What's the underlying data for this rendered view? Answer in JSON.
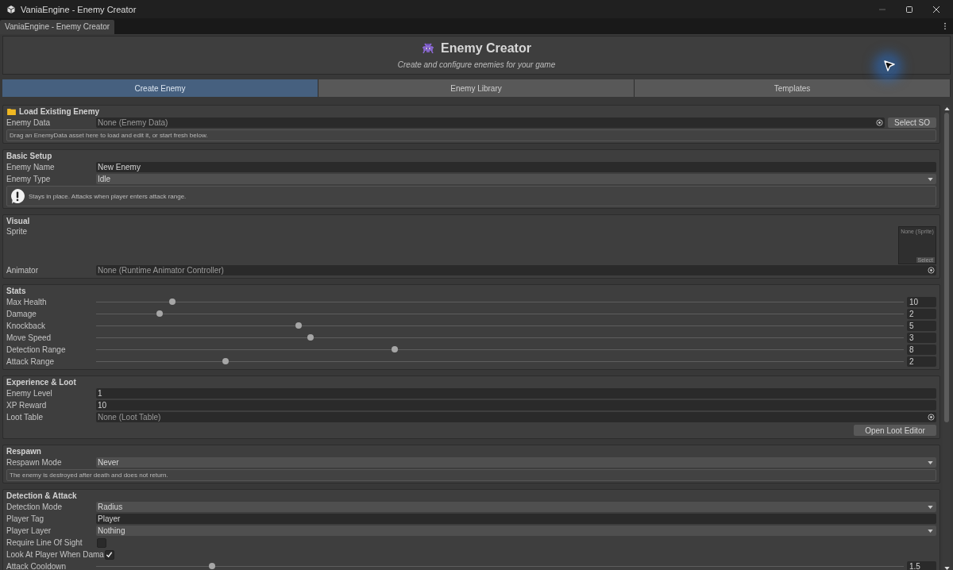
{
  "window": {
    "title": "VaniaEngine - Enemy Creator"
  },
  "dock_tab": {
    "label": "VaniaEngine - Enemy Creator",
    "selected": true
  },
  "header": {
    "title": "Enemy Creator",
    "subtitle": "Create and configure enemies for your game"
  },
  "tabs": [
    {
      "label": "Create Enemy",
      "selected": true
    },
    {
      "label": "Enemy Library",
      "selected": false
    },
    {
      "label": "Templates",
      "selected": false
    }
  ],
  "sections": [
    {
      "title": "Load Existing Enemy",
      "has_icon": true,
      "rows": [
        {
          "kind": "object",
          "label": "Enemy Data",
          "value": "None (Enemy Data)",
          "button": "Select SO"
        },
        {
          "kind": "note",
          "text": "Drag an EnemyData asset here to load and edit it, or start fresh below."
        }
      ]
    },
    {
      "title": "Basic Setup",
      "has_icon": false,
      "rows": [
        {
          "kind": "text",
          "label": "Enemy Name",
          "value": "New Enemy"
        },
        {
          "kind": "dropdown",
          "label": "Enemy Type",
          "value": "Idle"
        },
        {
          "kind": "info",
          "text": "Stays in place. Attacks when player enters attack range."
        }
      ]
    },
    {
      "title": "Visual",
      "has_icon": false,
      "rows": [
        {
          "kind": "sprite",
          "label": "Sprite",
          "value": "None (Sprite)",
          "button": "Select"
        },
        {
          "kind": "object",
          "label": "Animator",
          "value": "None (Runtime Animator Controller)"
        }
      ]
    },
    {
      "title": "Stats",
      "has_icon": false,
      "rows": [
        {
          "kind": "slider",
          "label": "Max Health",
          "level": 0.094,
          "value": "10"
        },
        {
          "kind": "slider",
          "label": "Damage",
          "level": 0.079,
          "value": "2"
        },
        {
          "kind": "slider",
          "label": "Knockback",
          "level": 0.251,
          "value": "5"
        },
        {
          "kind": "slider",
          "label": "Move Speed",
          "level": 0.265,
          "value": "3"
        },
        {
          "kind": "slider",
          "label": "Detection Range",
          "level": 0.37,
          "value": "8"
        },
        {
          "kind": "slider",
          "label": "Attack Range",
          "level": 0.16,
          "value": "2"
        }
      ]
    },
    {
      "title": "Experience & Loot",
      "has_icon": false,
      "rows": [
        {
          "kind": "text",
          "label": "Enemy Level",
          "value": "1"
        },
        {
          "kind": "text",
          "label": "XP Reward",
          "value": "10"
        },
        {
          "kind": "object",
          "label": "Loot Table",
          "value": "None (Loot Table)"
        },
        {
          "kind": "button",
          "button": "Open Loot Editor"
        }
      ]
    },
    {
      "title": "Respawn",
      "has_icon": false,
      "rows": [
        {
          "kind": "dropdown",
          "label": "Respawn Mode",
          "value": "Never"
        },
        {
          "kind": "note",
          "text": "The enemy is destroyed after death and does not return."
        }
      ]
    },
    {
      "title": "Detection & Attack",
      "has_icon": false,
      "rows": [
        {
          "kind": "dropdown",
          "label": "Detection Mode",
          "value": "Radius"
        },
        {
          "kind": "text",
          "label": "Player Tag",
          "value": "Player"
        },
        {
          "kind": "dropdown",
          "label": "Player Layer",
          "value": "Nothing"
        },
        {
          "kind": "checkbox",
          "label": "Require Line Of Sight",
          "checked": false
        },
        {
          "kind": "checkbox",
          "label": "Look At Player When Dama",
          "checked": true
        },
        {
          "kind": "slider",
          "label": "Attack Cooldown",
          "level": 0.144,
          "value": "1.5"
        }
      ]
    }
  ]
}
